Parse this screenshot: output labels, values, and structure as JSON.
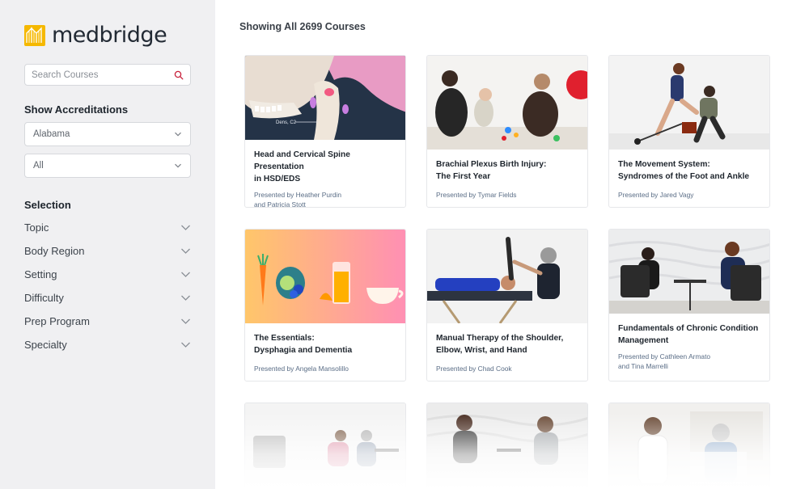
{
  "brand": {
    "name": "medbridge",
    "accent": "#f5b800",
    "search_icon_color": "#c8203a"
  },
  "search": {
    "placeholder": "Search Courses",
    "value": ""
  },
  "accreditations": {
    "title": "Show Accreditations",
    "state_value": "Alabama",
    "profession_value": "All"
  },
  "selection": {
    "title": "Selection",
    "facets": [
      {
        "label": "Topic",
        "icon": "chevron-down-icon"
      },
      {
        "label": "Body Region",
        "icon": "chevron-down-icon"
      },
      {
        "label": "Setting",
        "icon": "chevron-down-icon"
      },
      {
        "label": "Difficulty",
        "icon": "chevron-down-icon"
      },
      {
        "label": "Prep Program",
        "icon": "chevron-down-icon"
      },
      {
        "label": "Specialty",
        "icon": "chevron-down-icon"
      }
    ]
  },
  "results": {
    "showing_label": "Showing All 2699 Courses"
  },
  "courses": [
    {
      "title": "Head and Cervical Spine Presentation\nin HSD/EDS",
      "presenter": "Presented by Heather Purdin\nand Patricia Stott",
      "thumb_label": "Dens, C2"
    },
    {
      "title": "Brachial Plexus Birth Injury:\nThe First Year",
      "presenter": "Presented by Tymar Fields"
    },
    {
      "title": "The Movement System:\nSyndromes of the Foot and Ankle",
      "presenter": "Presented by Jared Vagy"
    },
    {
      "title": "The Essentials:\nDysphagia and Dementia",
      "presenter": "Presented by Angela Mansolillo"
    },
    {
      "title": "Manual Therapy of the Shoulder,\nElbow, Wrist, and Hand",
      "presenter": "Presented by Chad Cook"
    },
    {
      "title": "Fundamentals of Chronic Condition\nManagement",
      "presenter": "Presented by Cathleen Armato\nand Tina Marrelli"
    },
    {
      "title": "",
      "presenter": ""
    },
    {
      "title": "",
      "presenter": ""
    },
    {
      "title": "",
      "presenter": ""
    }
  ]
}
